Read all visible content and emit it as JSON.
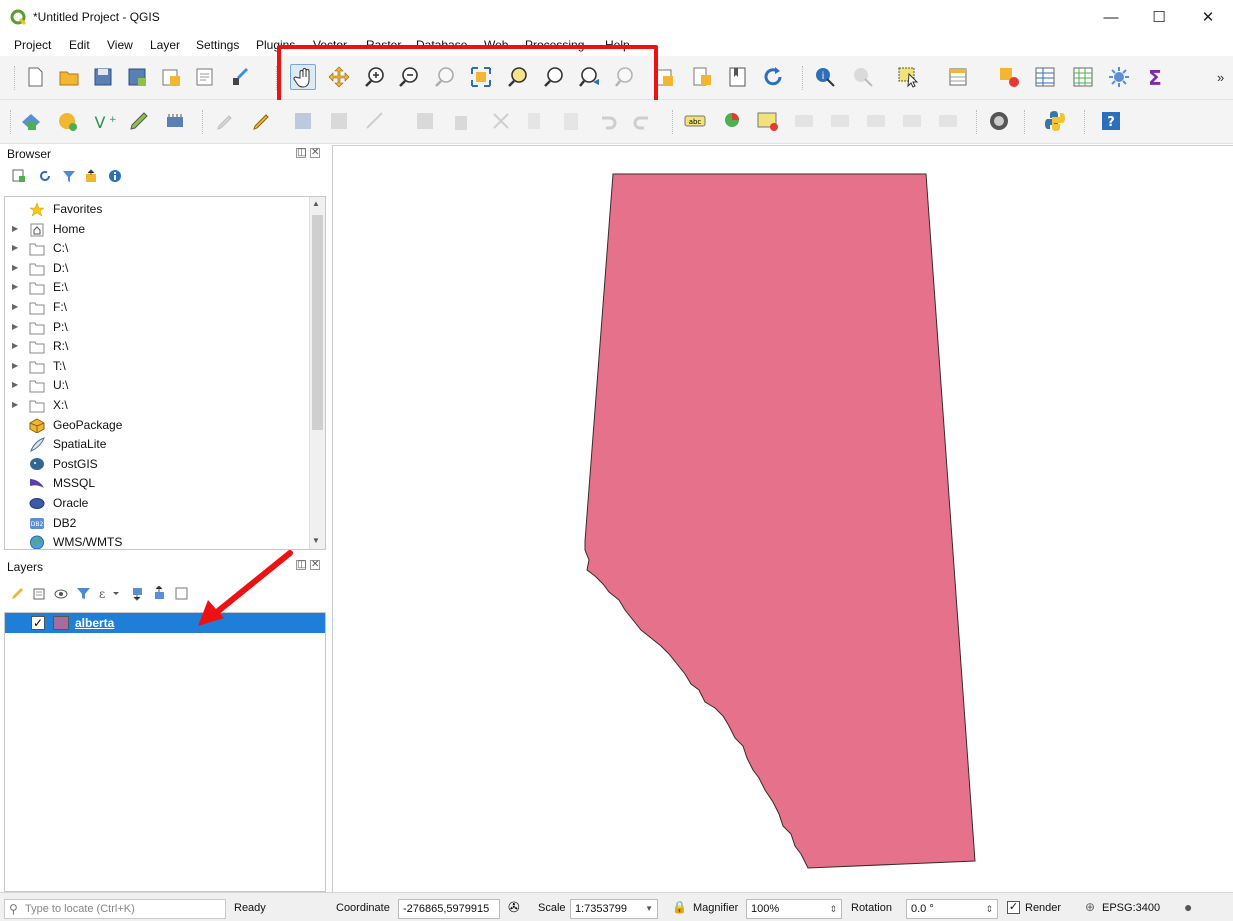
{
  "window": {
    "title": "*Untitled Project - QGIS",
    "minimize": "—",
    "maximize": "☐",
    "close": "✕"
  },
  "menu": [
    "Project",
    "Edit",
    "View",
    "Layer",
    "Settings",
    "Plugins",
    "Vector",
    "Raster",
    "Database",
    "Web",
    "Processing",
    "Help"
  ],
  "toolbar": {
    "overflow": "»"
  },
  "browser": {
    "title": "Browser",
    "items": [
      {
        "label": "Favorites",
        "icon": "star-icon",
        "expandable": false
      },
      {
        "label": "Home",
        "icon": "home-folder-icon",
        "expandable": true
      },
      {
        "label": "C:\\",
        "icon": "folder-icon",
        "expandable": true
      },
      {
        "label": "D:\\",
        "icon": "folder-icon",
        "expandable": true
      },
      {
        "label": "E:\\",
        "icon": "folder-icon",
        "expandable": true
      },
      {
        "label": "F:\\",
        "icon": "folder-icon",
        "expandable": true
      },
      {
        "label": "P:\\",
        "icon": "folder-icon",
        "expandable": true
      },
      {
        "label": "R:\\",
        "icon": "folder-icon",
        "expandable": true
      },
      {
        "label": "T:\\",
        "icon": "folder-icon",
        "expandable": true
      },
      {
        "label": "U:\\",
        "icon": "folder-icon",
        "expandable": true
      },
      {
        "label": "X:\\",
        "icon": "folder-icon",
        "expandable": true
      },
      {
        "label": "GeoPackage",
        "icon": "geopackage-icon",
        "expandable": false
      },
      {
        "label": "SpatiaLite",
        "icon": "spatialite-icon",
        "expandable": false
      },
      {
        "label": "PostGIS",
        "icon": "postgis-icon",
        "expandable": false
      },
      {
        "label": "MSSQL",
        "icon": "mssql-icon",
        "expandable": false
      },
      {
        "label": "Oracle",
        "icon": "oracle-icon",
        "expandable": false
      },
      {
        "label": "DB2",
        "icon": "db2-icon",
        "expandable": false
      },
      {
        "label": "WMS/WMTS",
        "icon": "wms-icon",
        "expandable": false
      }
    ]
  },
  "layers": {
    "title": "Layers",
    "items": [
      {
        "label": "alberta",
        "checked": true,
        "color": "#a86b9e"
      }
    ]
  },
  "map": {
    "polygon_fill": "#e6718b",
    "polygon_stroke": "#3a2a2a"
  },
  "status": {
    "locate_placeholder": "Type to locate (Ctrl+K)",
    "ready": "Ready",
    "coordinate_label": "Coordinate",
    "coordinate_value": "-276865,5979915",
    "scale_label": "Scale",
    "scale_value": "1:7353799",
    "magnifier_label": "Magnifier",
    "magnifier_value": "100%",
    "rotation_label": "Rotation",
    "rotation_value": "0.0 °",
    "render_label": "Render",
    "crs": "EPSG:3400"
  },
  "colors": {
    "highlight": "#ee1111",
    "selection": "#1f7fd8",
    "arrow": "#ee1111"
  }
}
